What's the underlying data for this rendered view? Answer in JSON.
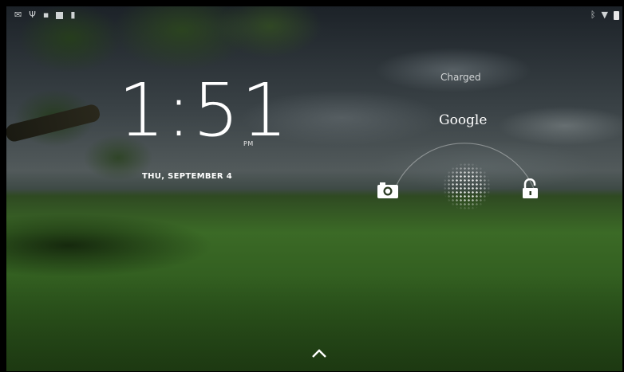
{
  "status_bar": {
    "left_icons": [
      "email-icon",
      "usb-icon",
      "lock-notification-icon",
      "no-sim-icon",
      "storage-icon"
    ],
    "right_icons": [
      "bluetooth-icon",
      "wifi-icon",
      "battery-icon"
    ]
  },
  "lockscreen": {
    "time": "1:51",
    "ampm": "PM",
    "date": "THU, SEPTEMBER 4",
    "charge_status": "Charged",
    "search_label": "Google"
  },
  "colors": {
    "text": "#ffffff",
    "status_icon": "#cfd3d4"
  }
}
